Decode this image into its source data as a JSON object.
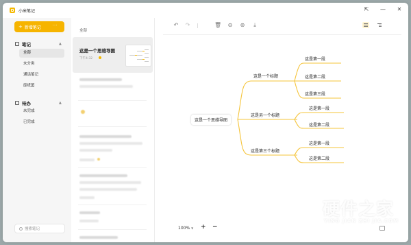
{
  "app": {
    "title": "小米笔记"
  },
  "sidebar": {
    "new_note": "新增笔记",
    "more": "···",
    "notes_section": {
      "label": "笔记",
      "items": [
        "全部",
        "未分类",
        "通话笔记",
        "废纸篓"
      ]
    },
    "todo_section": {
      "label": "待办",
      "items": [
        "未完成",
        "已完成"
      ]
    },
    "search_placeholder": "搜索笔记"
  },
  "list": {
    "header": "全部",
    "selected_note": {
      "title": "这是一个思维导图",
      "time": "下午4:32"
    }
  },
  "editor": {
    "toolbar_icons": [
      "undo-icon",
      "redo-icon",
      "trash-icon",
      "lock-icon",
      "share-icon",
      "download-icon",
      "outline-view-icon",
      "mindmap-view-icon"
    ],
    "mindmap": {
      "root": "这是一个思维导图",
      "branches": [
        {
          "label": "这是一个标题",
          "children": [
            "这是第一段",
            "这是第二段",
            "这是第三段"
          ]
        },
        {
          "label": "这是另一个标题",
          "children": [
            "这是第一段",
            "这是第二段"
          ]
        },
        {
          "label": "这是第三个标题",
          "children": [
            "这是第一段",
            "这是第二段"
          ]
        }
      ]
    },
    "zoom": "100%",
    "zoom_in": "+",
    "zoom_out": "−"
  },
  "watermark": {
    "title": "硬件之家",
    "subtitle": "YING JIAN ZHI JIA.COM"
  },
  "colors": {
    "accent": "#f6b400",
    "line": "#f5c43a"
  }
}
